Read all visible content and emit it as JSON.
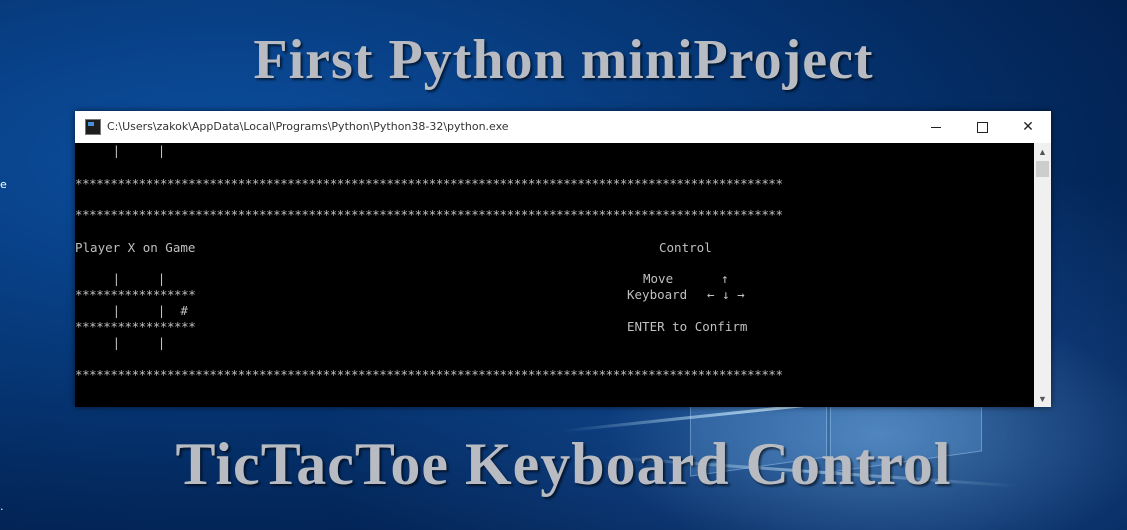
{
  "headline_top": "First Python miniProject",
  "headline_bottom": "TicTacToe Keyboard Control",
  "window": {
    "title": "C:\\Users\\zakok\\AppData\\Local\\Programs\\Python\\Python38-32\\python.exe",
    "minimize_glyph": "",
    "close_glyph": "✕"
  },
  "console": {
    "board_row_top": "     |     |",
    "separator": "****************************************************************************************************",
    "player_status": "Player X on Game",
    "control_title": "Control",
    "board_row_1": "     |     |",
    "board_divider_1": "*****************",
    "board_row_2": "     |     |  #",
    "board_divider_2": "*****************",
    "board_row_3": "     |     |",
    "move_label": "Move",
    "arrow_up": "↑",
    "keyboard_label": "Keyboard",
    "arrows_row": "← ↓ →",
    "enter_hint": "ENTER to Confirm"
  },
  "scrollbar": {
    "up_icon": "▲",
    "down_icon": "▼"
  },
  "desktop_edge_chars": [
    "e",
    "."
  ]
}
